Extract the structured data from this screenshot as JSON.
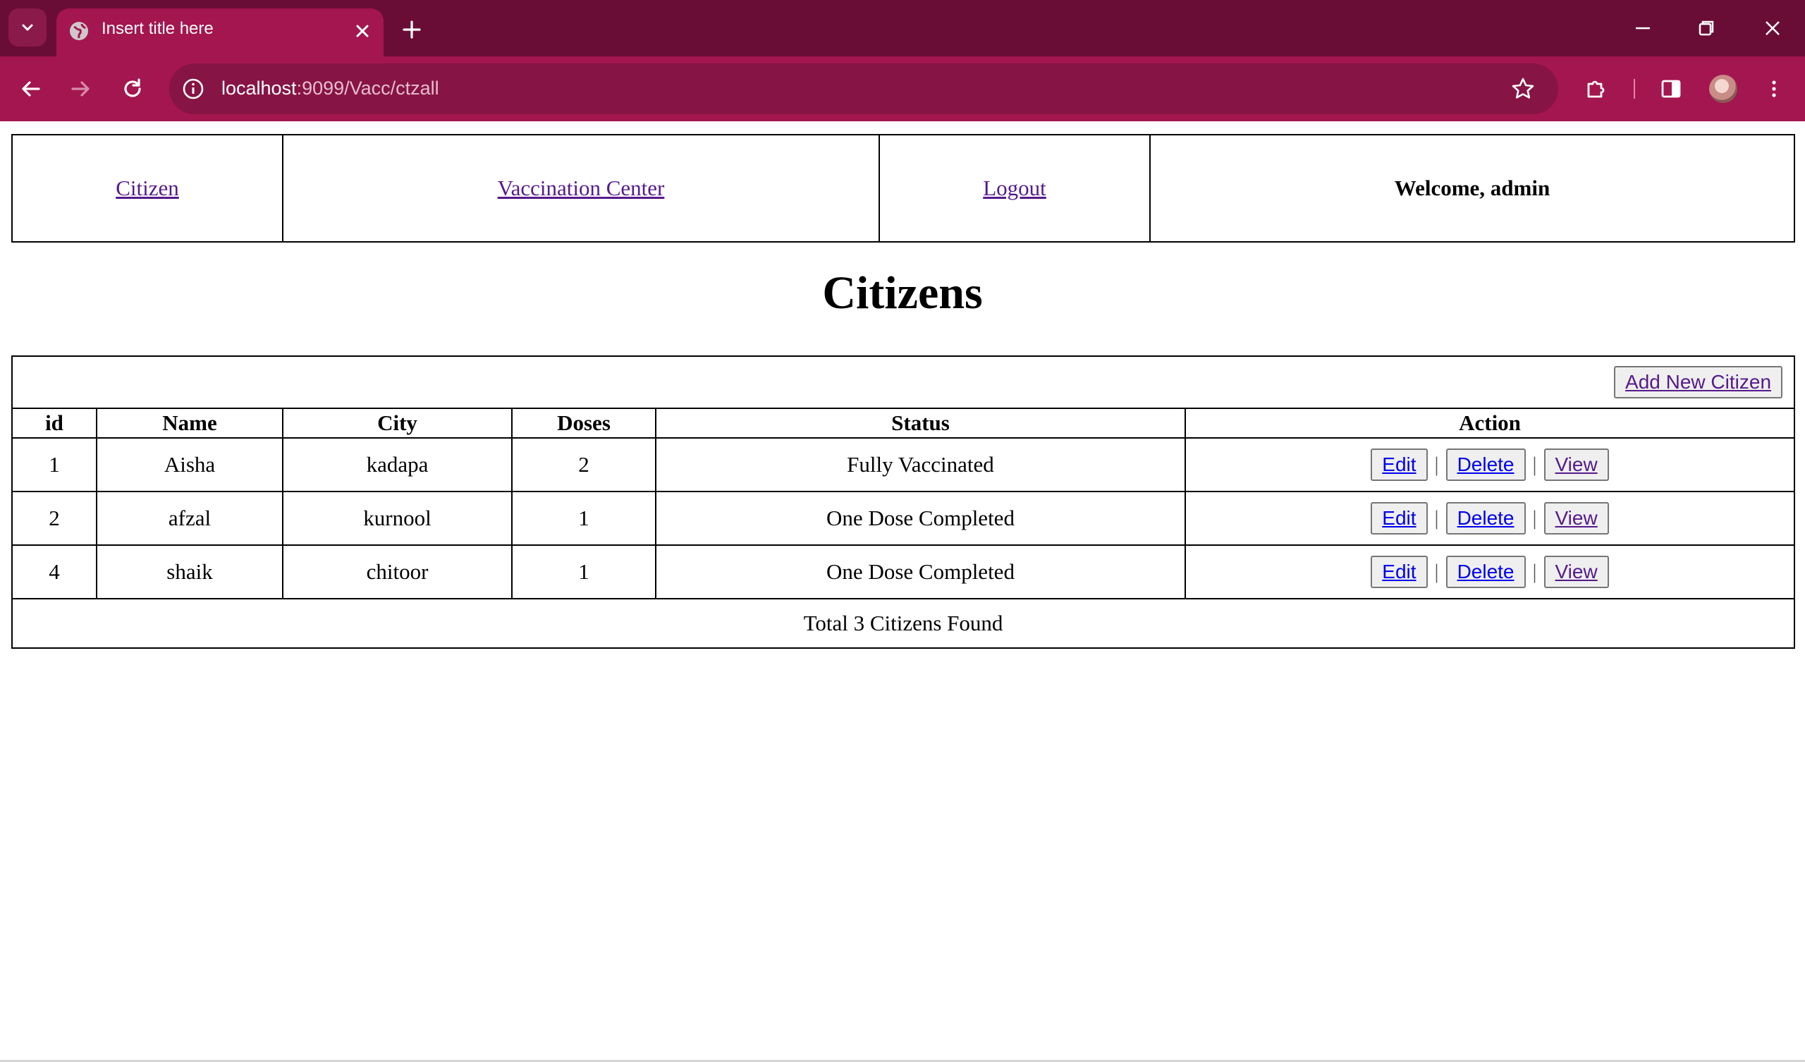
{
  "browser": {
    "tab_title": "Insert title here",
    "url_host": "localhost",
    "url_rest": ":9099/Vacc/ctzall",
    "icons": {
      "tab_search": "chevron-down-icon",
      "favicon": "globe-icon",
      "tab_close": "close-icon",
      "new_tab": "plus-icon",
      "minimize": "minimize-icon",
      "restore": "restore-icon",
      "close": "close-icon",
      "back": "back-arrow-icon",
      "forward": "forward-arrow-icon",
      "reload": "reload-icon",
      "site_info": "info-icon",
      "bookmark": "star-icon",
      "extensions": "puzzle-icon",
      "side_panel": "side-panel-icon",
      "menu": "kebab-menu-icon"
    },
    "colors": {
      "tabbar": "#6a0d36",
      "toolbar": "#a4164f",
      "omnibox": "#861444"
    }
  },
  "nav": {
    "citizen": "Citizen",
    "vaccination_center": "Vaccination Center",
    "logout": "Logout",
    "welcome": "Welcome, admin"
  },
  "page": {
    "heading": "Citizens",
    "add_button": "Add New Citizen",
    "total_text": "Total 3 Citizens Found"
  },
  "table": {
    "headers": {
      "id": "id",
      "name": "Name",
      "city": "City",
      "doses": "Doses",
      "status": "Status",
      "action": "Action"
    },
    "actions": {
      "edit": "Edit",
      "delete": "Delete",
      "view": "View",
      "separator": "|"
    },
    "rows": [
      {
        "id": "1",
        "name": "Aisha",
        "city": "kadapa",
        "doses": "2",
        "status": "Fully Vaccinated"
      },
      {
        "id": "2",
        "name": "afzal",
        "city": "kurnool",
        "doses": "1",
        "status": "One Dose Completed"
      },
      {
        "id": "4",
        "name": "shaik",
        "city": "chitoor",
        "doses": "1",
        "status": "One Dose Completed"
      }
    ]
  }
}
